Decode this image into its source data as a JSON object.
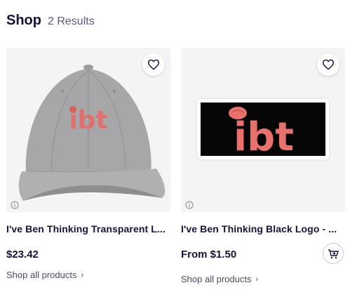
{
  "header": {
    "title": "Shop",
    "count": "2 Results"
  },
  "products": [
    {
      "title": "I've Ben Thinking Transparent L...",
      "price": "$23.42",
      "shop_link": "Shop all products",
      "image_logo_text": "ibt"
    },
    {
      "title": "I've Ben Thinking Black Logo - ...",
      "price": "From $1.50",
      "shop_link": "Shop all products",
      "image_logo_text": "ibt"
    }
  ],
  "colors": {
    "logo": "#e8716d",
    "cap": "#a8a8aa",
    "sticker_bg": "#050505"
  },
  "icons": {
    "favorite": "heart-icon",
    "info": "info-icon",
    "cart": "add-to-cart-icon",
    "chevron": "chevron-right-icon"
  }
}
